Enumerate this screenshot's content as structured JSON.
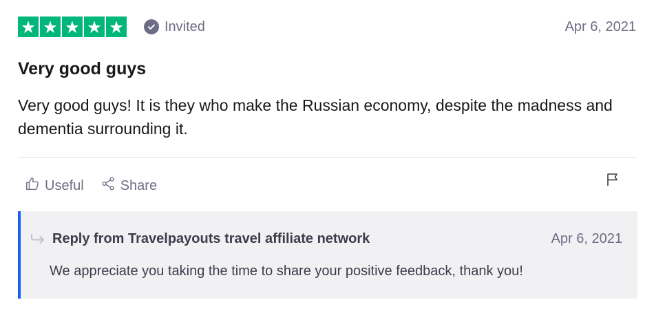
{
  "review": {
    "rating": 5,
    "rating_max": 5,
    "star_color": "#00b67a",
    "badge_label": "Invited",
    "date": "Apr 6, 2021",
    "title": "Very good guys",
    "text": "Very good guys! It is they who make the Russian economy, despite the madness and dementia surrounding it."
  },
  "actions": {
    "useful_label": "Useful",
    "share_label": "Share"
  },
  "reply": {
    "accent_color": "#1c5bf2",
    "from": "Reply from Travelpayouts travel affiliate network",
    "date": "Apr 6, 2021",
    "text": "We appreciate you taking the time to share your positive feedback, thank you!"
  }
}
